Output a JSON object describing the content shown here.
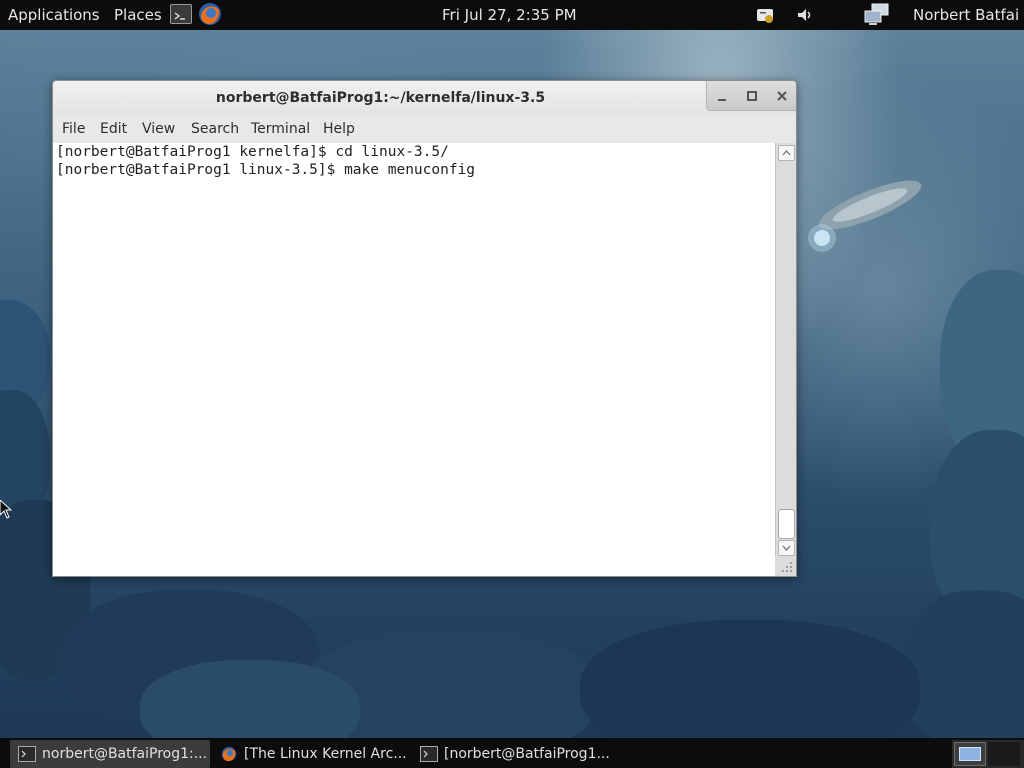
{
  "top_panel": {
    "applications": "Applications",
    "places": "Places",
    "clock": "Fri Jul 27,  2:35 PM",
    "user": "Norbert Batfai"
  },
  "window": {
    "title": "norbert@BatfaiProg1:~/kernelfa/linux-3.5",
    "menu": [
      "File",
      "Edit",
      "View",
      "Search",
      "Terminal",
      "Help"
    ]
  },
  "terminal": {
    "lines": [
      "[norbert@BatfaiProg1 kernelfa]$ cd linux-3.5/",
      "[norbert@BatfaiProg1 linux-3.5]$ make menuconfig"
    ]
  },
  "taskbar": {
    "tasks": [
      {
        "label": "norbert@BatfaiProg1:...",
        "icon": "terminal-icon",
        "active": true
      },
      {
        "label": "[The Linux Kernel Arc...",
        "icon": "firefox-icon",
        "active": false
      },
      {
        "label": "[norbert@BatfaiProg1...",
        "icon": "terminal-icon",
        "active": false
      }
    ]
  },
  "icons": {
    "launcher_terminal": "terminal-icon",
    "launcher_firefox": "firefox-icon",
    "notification": "notification-icon",
    "volume": "volume-icon",
    "network": "network-icon"
  },
  "colors": {
    "panel": "#0c0c0c",
    "terminal_bg": "#ffffff",
    "window_chrome": "#e8e8e7"
  }
}
